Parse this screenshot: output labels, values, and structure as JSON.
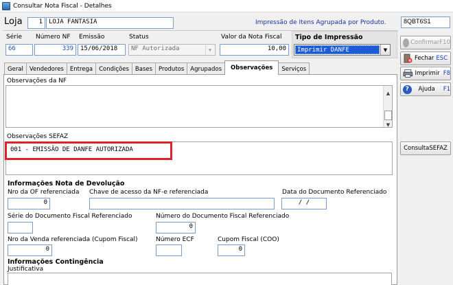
{
  "window": {
    "title": "Consultar Nota Fiscal - Detalhes"
  },
  "header": {
    "loja_label": "Loja",
    "loja_code": "1",
    "loja_name": "LOJA FANTASIA",
    "agrupada_text": "Impressão de Itens Agrupada por Produto.",
    "station_code": "8QBT6S1"
  },
  "nf": {
    "serie_label": "Série",
    "serie_value": "66",
    "numero_label": "Número NF",
    "numero_value": "339",
    "emissao_label": "Emissão",
    "emissao_value": "15/06/2018",
    "status_label": "Status",
    "status_value": "NF Autorizada",
    "valor_label": "Valor da Nota Fiscal",
    "valor_value": "10,00",
    "tipo_impressao_label": "Tipo de Impressão",
    "tipo_impressao_value": "Imprimir DANFE"
  },
  "tabs": [
    {
      "label": "Geral"
    },
    {
      "label": "Vendedores"
    },
    {
      "label": "Entrega"
    },
    {
      "label": "Condições"
    },
    {
      "label": "Bases"
    },
    {
      "label": "Produtos"
    },
    {
      "label": "Agrupados"
    },
    {
      "label": "Observações"
    },
    {
      "label": "Serviços"
    }
  ],
  "active_tab": "Observações",
  "observacoes": {
    "obs_nf_label": "Observações da NF",
    "obs_nf_value": "",
    "obs_sefaz_label": "Observações SEFAZ",
    "obs_sefaz_value": "001 - EMISSÃO DE DANFE AUTORIZADA"
  },
  "devolucao": {
    "section_title": "Informações Nota de Devolução",
    "nro_of_label": "Nro da OF referenciada",
    "nro_of_value": "0",
    "chave_label": "Chave de acesso da NF-e referenciada",
    "chave_value": "",
    "data_doc_label": "Data do Documento Referenciado",
    "data_doc_value": "/   /",
    "serie_doc_label": "Série do Documento Fiscal Referenciado",
    "serie_doc_value": "",
    "numero_doc_label": "Número do Documento Fiscal Referenciado",
    "numero_doc_value": "0",
    "nro_venda_label": "Nro da Venda referenciada (Cupom Fiscal)",
    "nro_venda_value": "0",
    "numero_ecf_label": "Número ECF",
    "numero_ecf_value": "",
    "cupom_label": "Cupom Fiscal (COO)",
    "cupom_value": "0"
  },
  "contingencia": {
    "section_title": "Informações Contingência",
    "justificativa_label": "Justificativa",
    "justificativa_value": ""
  },
  "side_buttons": {
    "confirmar_label": "Confirmar",
    "confirmar_key": "F10",
    "fechar_label": "Fechar",
    "fechar_key": "ESC",
    "imprimir_label": "Imprimir",
    "imprimir_key": "F8",
    "ajuda_label": "Ajuda",
    "ajuda_key": "F1",
    "consulta_sefaz_label": "ConsultaSEFAZ"
  },
  "colors": {
    "highlight_red": "#e0202a",
    "accent_blue": "#1a2fa0",
    "selection_blue": "#1c5bd6"
  }
}
